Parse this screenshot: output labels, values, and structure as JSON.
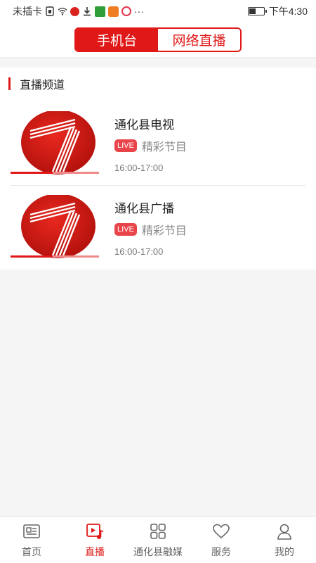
{
  "status_bar": {
    "carrier": "未插卡",
    "more": "···",
    "time": "下午4:30"
  },
  "header": {
    "tabs": [
      {
        "label": "手机台",
        "active": true
      },
      {
        "label": "网络直播",
        "active": false
      }
    ]
  },
  "section": {
    "title": "直播频道"
  },
  "channels": [
    {
      "name": "通化县电视",
      "live_label": "LIVE",
      "program": "精彩节目",
      "time": "16:00-17:00"
    },
    {
      "name": "通化县广播",
      "live_label": "LIVE",
      "program": "精彩节目",
      "time": "16:00-17:00"
    }
  ],
  "bottom_nav": {
    "items": [
      {
        "label": "首页",
        "icon": "news-icon",
        "active": false
      },
      {
        "label": "直播",
        "icon": "live-video-icon",
        "active": true
      },
      {
        "label": "通化县融媒",
        "icon": "grid-icon",
        "active": false
      },
      {
        "label": "服务",
        "icon": "heart-icon",
        "active": false
      },
      {
        "label": "我的",
        "icon": "user-icon",
        "active": false
      }
    ]
  },
  "colors": {
    "accent": "#e01818",
    "live_badge": "#e8444a"
  }
}
